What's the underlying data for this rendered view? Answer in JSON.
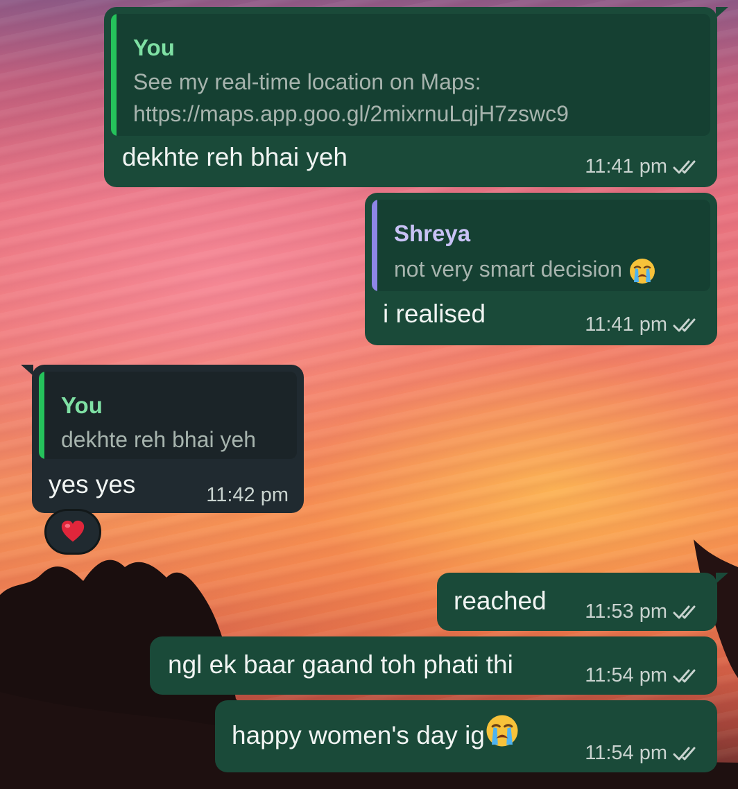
{
  "colors": {
    "outgoing_bubble": "#1a4a39",
    "incoming_bubble": "#202a30",
    "quote_you": "#25c25b",
    "quote_shreya": "#8e86e6",
    "quote_author_you": "#7fe0a4",
    "quote_author_shreya": "#c8c2f5",
    "read_ticks": "#c9d3cf"
  },
  "icons": {
    "read_receipt": "double-check-icon",
    "crying_face": "loudly-crying-face-emoji",
    "heart": "red-heart-emoji"
  },
  "messages": [
    {
      "direction": "outgoing",
      "quote": {
        "author": "You",
        "text_line1": "See my real-time location on Maps:",
        "text_line2": "https://maps.app.goo.gl/2mixrnuLqjH7zswc9"
      },
      "text": "dekhte reh bhai yeh",
      "time": "11:41 pm",
      "status": "read"
    },
    {
      "direction": "outgoing",
      "quote": {
        "author": "Shreya",
        "text": "not very smart decision"
      },
      "text": "i realised",
      "time": "11:41 pm",
      "status": "read"
    },
    {
      "direction": "incoming",
      "quote": {
        "author": "You",
        "text": "dekhte reh bhai yeh"
      },
      "text": "yes yes",
      "time": "11:42 pm",
      "reaction": "❤️"
    },
    {
      "direction": "outgoing",
      "text": "reached",
      "time": "11:53 pm",
      "status": "read"
    },
    {
      "direction": "outgoing",
      "text": "ngl ek baar gaand toh phati thi",
      "time": "11:54 pm",
      "status": "read"
    },
    {
      "direction": "outgoing",
      "text": "happy women's day ig",
      "time": "11:54 pm",
      "status": "read"
    }
  ]
}
